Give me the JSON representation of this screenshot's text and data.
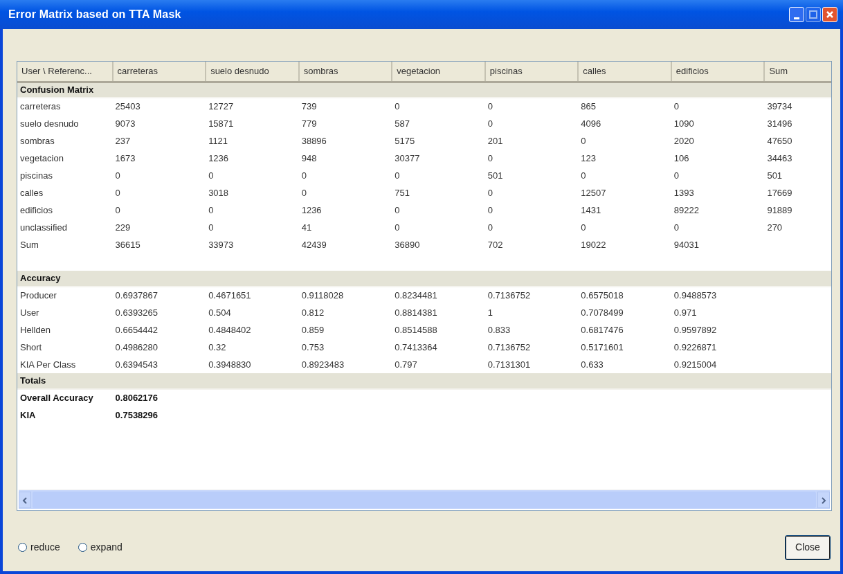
{
  "window": {
    "title": "Error Matrix based on TTA Mask"
  },
  "table": {
    "columns": [
      "User \\ Referenc...",
      "carreteras",
      "suelo desnudo",
      "sombras",
      "vegetacion",
      "piscinas",
      "calles",
      "edificios",
      "Sum"
    ],
    "sections": [
      {
        "title": "Confusion Matrix",
        "kind": "matrix",
        "rows": [
          {
            "label": "carreteras",
            "cells": [
              "25403",
              "12727",
              "739",
              "0",
              "0",
              "865",
              "0",
              "39734"
            ]
          },
          {
            "label": "suelo desnudo",
            "cells": [
              "9073",
              "15871",
              "779",
              "587",
              "0",
              "4096",
              "1090",
              "31496"
            ]
          },
          {
            "label": "sombras",
            "cells": [
              "237",
              "1121",
              "38896",
              "5175",
              "201",
              "0",
              "2020",
              "47650"
            ]
          },
          {
            "label": "vegetacion",
            "cells": [
              "1673",
              "1236",
              "948",
              "30377",
              "0",
              "123",
              "106",
              "34463"
            ]
          },
          {
            "label": "piscinas",
            "cells": [
              "0",
              "0",
              "0",
              "0",
              "501",
              "0",
              "0",
              "501"
            ]
          },
          {
            "label": "calles",
            "cells": [
              "0",
              "3018",
              "0",
              "751",
              "0",
              "12507",
              "1393",
              "17669"
            ]
          },
          {
            "label": "edificios",
            "cells": [
              "0",
              "0",
              "1236",
              "0",
              "0",
              "1431",
              "89222",
              "91889"
            ]
          },
          {
            "label": "unclassified",
            "cells": [
              "229",
              "0",
              "41",
              "0",
              "0",
              "0",
              "0",
              "270"
            ]
          },
          {
            "label": "Sum",
            "cells": [
              "36615",
              "33973",
              "42439",
              "36890",
              "702",
              "19022",
              "94031"
            ]
          }
        ]
      },
      {
        "title": "Accuracy",
        "kind": "accuracy",
        "rows": [
          {
            "label": "Producer",
            "cells": [
              "0.6937867",
              "0.4671651",
              "0.9118028",
              "0.8234481",
              "0.7136752",
              "0.6575018",
              "0.9488573"
            ]
          },
          {
            "label": "User",
            "cells": [
              "0.6393265",
              "0.504",
              "0.812",
              "0.8814381",
              "1",
              "0.7078499",
              "0.971"
            ]
          },
          {
            "label": "Hellden",
            "cells": [
              "0.6654442",
              "0.4848402",
              "0.859",
              "0.8514588",
              "0.833",
              "0.6817476",
              "0.9597892"
            ]
          },
          {
            "label": "Short",
            "cells": [
              "0.4986280",
              "0.32",
              "0.753",
              "0.7413364",
              "0.7136752",
              "0.5171601",
              "0.9226871"
            ]
          },
          {
            "label": "KIA Per Class",
            "cells": [
              "0.6394543",
              "0.3948830",
              "0.8923483",
              "0.797",
              "0.7131301",
              "0.633",
              "0.9215004"
            ]
          }
        ]
      },
      {
        "title": "Totals",
        "kind": "totals",
        "rows": [
          {
            "label": "Overall Accuracy",
            "cells": [
              "0.8062176"
            ]
          },
          {
            "label": "KIA",
            "cells": [
              "0.7538296"
            ]
          }
        ]
      }
    ]
  },
  "options": [
    {
      "label": "reduce",
      "selected": false
    },
    {
      "label": "expand",
      "selected": false
    }
  ],
  "buttons": [
    "Close"
  ]
}
